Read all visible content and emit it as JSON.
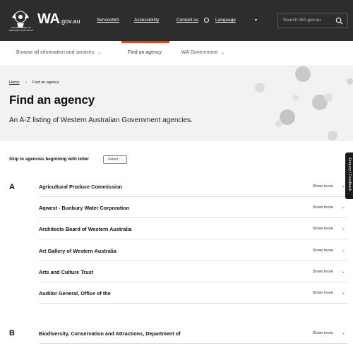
{
  "header": {
    "crest_caption": "GOVERNMENT OF WESTERN AUSTRALIA",
    "brand_main": "WA",
    "brand_suffix": ".gov.au",
    "links": [
      "ServiceWA",
      "Accessibility",
      "Contact us",
      "Language"
    ],
    "search_placeholder": "Search WA.gov.au"
  },
  "nav": {
    "items": [
      "Browse all information and services",
      "Find an agency",
      "WA Government"
    ],
    "active_index": 1
  },
  "breadcrumb": {
    "home": "Home",
    "separator": "›",
    "current": "Find an agency"
  },
  "hero": {
    "title": "Find an agency",
    "subtitle": "An A-Z listing of Western Australian Government agencies."
  },
  "skip": {
    "label": "Skip to agencies beginning with letter",
    "selected": "- Select -"
  },
  "groups": [
    {
      "letter": "A",
      "agencies": [
        "Agricultural Produce Commission",
        "Aqwest - Bunbury Water Corporation",
        "Architects Board of Western Australia",
        "Art Gallery of Western Australia",
        "Arts and Culture Trust",
        "Auditor General, Office of the"
      ]
    },
    {
      "letter": "B",
      "agencies": [
        "Biodiversity, Conservation and Attractions, Department of"
      ]
    }
  ],
  "show_more_label": "Show more",
  "feedback_label": "Enquiry / Feedback",
  "colors": {
    "header_bg": "#2d2d2d",
    "accent": "#c8501e",
    "hero_bg": "#f2f2f2"
  }
}
